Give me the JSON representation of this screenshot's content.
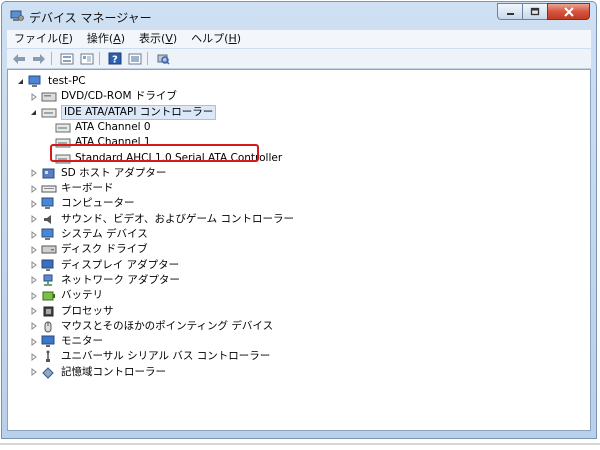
{
  "window": {
    "title": "デバイス マネージャー"
  },
  "menu": [
    {
      "label": "ファイル(",
      "key": "F",
      "suffix": ")"
    },
    {
      "label": "操作(",
      "key": "A",
      "suffix": ")"
    },
    {
      "label": "表示(",
      "key": "V",
      "suffix": ")"
    },
    {
      "label": "ヘルプ(",
      "key": "H",
      "suffix": ")"
    }
  ],
  "toolbar": {
    "back": "back-arrow-icon",
    "forward": "forward-arrow-icon",
    "properties": "properties-icon",
    "refresh": "list-icon",
    "help": "help-icon",
    "view": "view-icon",
    "scan": "scan-hardware-icon"
  },
  "tree": {
    "root": "test-PC",
    "items": [
      {
        "label": "DVD/CD-ROM ドライブ",
        "icon": "dvd-icon"
      },
      {
        "label": "IDE ATA/ATAPI コントローラー",
        "icon": "ide-controller-icon",
        "expanded": true,
        "selected": true,
        "children": [
          {
            "label": "ATA Channel 0",
            "icon": "controller-icon"
          },
          {
            "label": "ATA Channel 1",
            "icon": "controller-icon"
          },
          {
            "label": "Standard AHCI 1.0 Serial ATA Controller",
            "icon": "controller-icon",
            "highlighted": true
          }
        ]
      },
      {
        "label": "SD ホスト アダプター",
        "icon": "sd-host-icon"
      },
      {
        "label": "キーボード",
        "icon": "keyboard-icon"
      },
      {
        "label": "コンピューター",
        "icon": "computer-icon"
      },
      {
        "label": "サウンド、ビデオ、およびゲーム コントローラー",
        "icon": "speaker-icon"
      },
      {
        "label": "システム デバイス",
        "icon": "system-device-icon"
      },
      {
        "label": "ディスク ドライブ",
        "icon": "disk-drive-icon"
      },
      {
        "label": "ディスプレイ アダプター",
        "icon": "display-adapter-icon"
      },
      {
        "label": "ネットワーク アダプター",
        "icon": "network-icon"
      },
      {
        "label": "バッテリ",
        "icon": "battery-icon"
      },
      {
        "label": "プロセッサ",
        "icon": "processor-icon"
      },
      {
        "label": "マウスとそのほかのポインティング デバイス",
        "icon": "mouse-icon"
      },
      {
        "label": "モニター",
        "icon": "monitor-icon"
      },
      {
        "label": "ユニバーサル シリアル バス コントローラー",
        "icon": "usb-icon"
      },
      {
        "label": "記憶域コントローラー",
        "icon": "storage-controller-icon"
      }
    ]
  },
  "colors": {
    "highlight_border": "#d41a1a",
    "selection": "#dbe8f7",
    "frame": "#b9d0ea"
  }
}
